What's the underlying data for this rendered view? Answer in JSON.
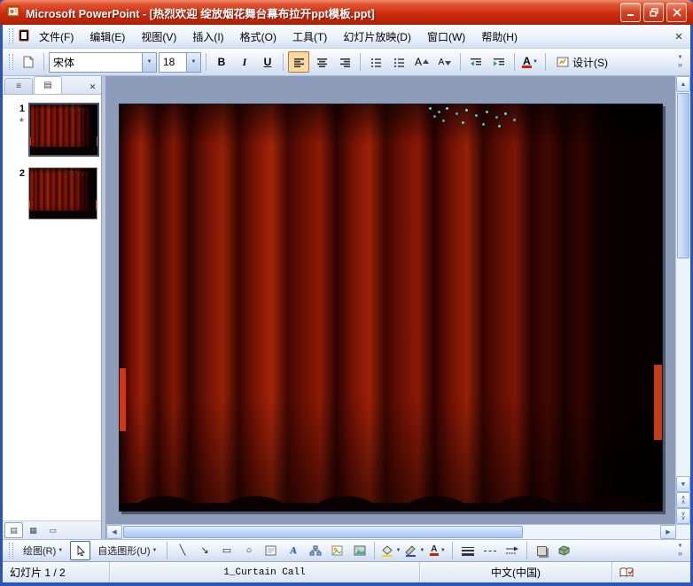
{
  "window": {
    "title": "Microsoft PowerPoint - [热烈欢迎 绽放烟花舞台幕布拉开ppt模板.ppt]"
  },
  "menu": {
    "items": [
      "文件(F)",
      "编辑(E)",
      "视图(V)",
      "插入(I)",
      "格式(O)",
      "工具(T)",
      "幻灯片放映(D)",
      "窗口(W)",
      "帮助(H)"
    ]
  },
  "format_toolbar": {
    "font_name": "宋体",
    "font_size": "18",
    "bold": "B",
    "italic": "I",
    "underline": "U",
    "design_label": "设计(S)"
  },
  "slides_panel": {
    "slides": [
      {
        "number": "1",
        "selected": true,
        "has_animation": true
      },
      {
        "number": "2",
        "selected": false
      }
    ]
  },
  "drawing_toolbar": {
    "draw_label": "绘图(R)",
    "autoshapes_label": "自选图形(U)"
  },
  "status_bar": {
    "slide_info": "幻灯片 1 / 2",
    "design_name": "1_Curtain Call",
    "language": "中文(中国)"
  },
  "glyphs": {
    "close": "✕",
    "dropdown": "▼",
    "up_arrow": "▲",
    "down_arrow": "▼",
    "left_arrow": "◀",
    "right_arrow": "▶",
    "chevron_up": "∧",
    "chevron_down": "∨",
    "chevrons_more": "»",
    "line": "╲",
    "arrow": "↘",
    "rectangle": "▭",
    "oval": "○",
    "star": "★",
    "letter_a": "A",
    "outline_tab": "≡",
    "slides_tab": "▤",
    "normal_view": "▤",
    "sorter_view": "▦",
    "slideshow_view": "▭"
  },
  "colors": {
    "titlebar_red": "#cb2c0e",
    "frame_blue": "#2a52c0",
    "workspace_gray": "#8d9cb8",
    "curtain_red": "#8a1604",
    "pressed_orange": "#fcd9a0",
    "fireworks_cyan": "#45d8dc"
  }
}
